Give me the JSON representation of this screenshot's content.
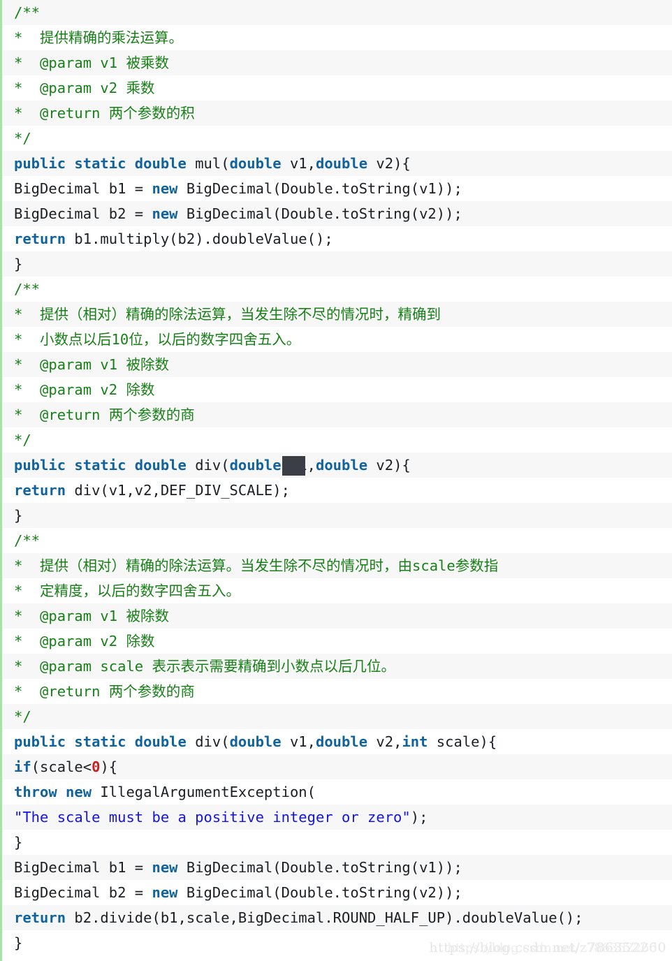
{
  "editor": {
    "language": "java",
    "colors": {
      "comment": "#178017",
      "keyword": "#10639c",
      "string": "#1414e0",
      "number": "#c92020",
      "plain": "#1b1f23",
      "row_odd_bg": "#f7f7f7",
      "row_even_bg": "#ffffff",
      "left_stripe": "#a6e3a6",
      "caret_block": "#3b3f45"
    },
    "caret": {
      "line_index": 18,
      "label": "text-cursor-block"
    },
    "lines": [
      {
        "i": 0,
        "text": "/**",
        "kind": "comment"
      },
      {
        "i": 1,
        "text": "* 提供精确的乘法运算。",
        "kind": "comment"
      },
      {
        "i": 2,
        "text": "* @param v1 被乘数",
        "kind": "comment"
      },
      {
        "i": 3,
        "text": "* @param v2 乘数",
        "kind": "comment"
      },
      {
        "i": 4,
        "text": "* @return 两个参数的积",
        "kind": "comment"
      },
      {
        "i": 5,
        "text": "*/",
        "kind": "comment"
      },
      {
        "i": 6,
        "text": "public static double mul(double v1,double v2){",
        "kind": "code"
      },
      {
        "i": 7,
        "text": "BigDecimal b1 = new BigDecimal(Double.toString(v1));",
        "kind": "code"
      },
      {
        "i": 8,
        "text": "BigDecimal b2 = new BigDecimal(Double.toString(v2));",
        "kind": "code"
      },
      {
        "i": 9,
        "text": "return b1.multiply(b2).doubleValue();",
        "kind": "code"
      },
      {
        "i": 10,
        "text": "}",
        "kind": "code"
      },
      {
        "i": 11,
        "text": "/**",
        "kind": "comment"
      },
      {
        "i": 12,
        "text": "* 提供（相对）精确的除法运算，当发生除不尽的情况时，精确到",
        "kind": "comment"
      },
      {
        "i": 13,
        "text": "* 小数点以后10位，以后的数字四舍五入。",
        "kind": "comment"
      },
      {
        "i": 14,
        "text": "* @param v1 被除数",
        "kind": "comment"
      },
      {
        "i": 15,
        "text": "* @param v2 除数",
        "kind": "comment"
      },
      {
        "i": 16,
        "text": "* @return 两个参数的商",
        "kind": "comment"
      },
      {
        "i": 17,
        "text": "*/",
        "kind": "comment"
      },
      {
        "i": 18,
        "text": "public static double div(double v1,double v2){",
        "kind": "code"
      },
      {
        "i": 19,
        "text": "return div(v1,v2,DEF_DIV_SCALE);",
        "kind": "code"
      },
      {
        "i": 20,
        "text": "}",
        "kind": "code"
      },
      {
        "i": 21,
        "text": "/**",
        "kind": "comment"
      },
      {
        "i": 22,
        "text": "* 提供（相对）精确的除法运算。当发生除不尽的情况时，由scale参数指",
        "kind": "comment"
      },
      {
        "i": 23,
        "text": "* 定精度，以后的数字四舍五入。",
        "kind": "comment"
      },
      {
        "i": 24,
        "text": "* @param v1 被除数",
        "kind": "comment"
      },
      {
        "i": 25,
        "text": "* @param v2 除数",
        "kind": "comment"
      },
      {
        "i": 26,
        "text": "* @param scale 表示表示需要精确到小数点以后几位。",
        "kind": "comment"
      },
      {
        "i": 27,
        "text": "* @return 两个参数的商",
        "kind": "comment"
      },
      {
        "i": 28,
        "text": "*/",
        "kind": "comment"
      },
      {
        "i": 29,
        "text": "public static double div(double v1,double v2,int scale){",
        "kind": "code"
      },
      {
        "i": 30,
        "text": "if(scale<0){",
        "kind": "code"
      },
      {
        "i": 31,
        "text": "throw new IllegalArgumentException(",
        "kind": "code"
      },
      {
        "i": 32,
        "text": "\"The scale must be a positive integer or zero\");",
        "kind": "code"
      },
      {
        "i": 33,
        "text": "}",
        "kind": "code"
      },
      {
        "i": 34,
        "text": "BigDecimal b1 = new BigDecimal(Double.toString(v1));",
        "kind": "code"
      },
      {
        "i": 35,
        "text": "BigDecimal b2 = new BigDecimal(Double.toString(v2));",
        "kind": "code"
      },
      {
        "i": 36,
        "text": "return b2.divide(b1,scale,BigDecimal.ROUND_HALF_UP).doubleValue();",
        "kind": "code"
      },
      {
        "i": 37,
        "text": "}",
        "kind": "code"
      }
    ],
    "tokens": [
      {
        "i": 0,
        "parts": [
          {
            "t": "/**",
            "c": "comment"
          }
        ]
      },
      {
        "i": 1,
        "parts": [
          {
            "t": "*  提供精确的乘法运算。",
            "c": "comment"
          }
        ]
      },
      {
        "i": 2,
        "parts": [
          {
            "t": "*  @param v1 被乘数",
            "c": "comment"
          }
        ]
      },
      {
        "i": 3,
        "parts": [
          {
            "t": "*  @param v2 乘数",
            "c": "comment"
          }
        ]
      },
      {
        "i": 4,
        "parts": [
          {
            "t": "*  @return 两个参数的积",
            "c": "comment"
          }
        ]
      },
      {
        "i": 5,
        "parts": [
          {
            "t": "*/",
            "c": "comment"
          }
        ]
      },
      {
        "i": 6,
        "parts": [
          {
            "t": "public static double ",
            "c": "kw"
          },
          {
            "t": "mul(",
            "c": "plain"
          },
          {
            "t": "double",
            "c": "kw"
          },
          {
            "t": " v1,",
            "c": "plain"
          },
          {
            "t": "double",
            "c": "kw"
          },
          {
            "t": " v2){",
            "c": "plain"
          }
        ]
      },
      {
        "i": 7,
        "parts": [
          {
            "t": "BigDecimal b1 = ",
            "c": "plain"
          },
          {
            "t": "new",
            "c": "kw"
          },
          {
            "t": " BigDecimal(Double.toString(v1));",
            "c": "plain"
          }
        ]
      },
      {
        "i": 8,
        "parts": [
          {
            "t": "BigDecimal b2 = ",
            "c": "plain"
          },
          {
            "t": "new",
            "c": "kw"
          },
          {
            "t": " BigDecimal(Double.toString(v2));",
            "c": "plain"
          }
        ]
      },
      {
        "i": 9,
        "parts": [
          {
            "t": "return",
            "c": "kw"
          },
          {
            "t": " b1.multiply(b2).doubleValue();",
            "c": "plain"
          }
        ]
      },
      {
        "i": 10,
        "parts": [
          {
            "t": "}",
            "c": "plain"
          }
        ]
      },
      {
        "i": 11,
        "parts": [
          {
            "t": "/**",
            "c": "comment"
          }
        ]
      },
      {
        "i": 12,
        "parts": [
          {
            "t": "*  提供（相对）精确的除法运算，当发生除不尽的情况时，精确到",
            "c": "comment"
          }
        ]
      },
      {
        "i": 13,
        "parts": [
          {
            "t": "*  小数点以后10位，以后的数字四舍五入。",
            "c": "comment"
          }
        ]
      },
      {
        "i": 14,
        "parts": [
          {
            "t": "*  @param v1 被除数",
            "c": "comment"
          }
        ]
      },
      {
        "i": 15,
        "parts": [
          {
            "t": "*  @param v2 除数",
            "c": "comment"
          }
        ]
      },
      {
        "i": 16,
        "parts": [
          {
            "t": "*  @return 两个参数的商",
            "c": "comment"
          }
        ]
      },
      {
        "i": 17,
        "parts": [
          {
            "t": "*/",
            "c": "comment"
          }
        ]
      },
      {
        "i": 18,
        "parts": [
          {
            "t": "public static double ",
            "c": "kw"
          },
          {
            "t": "div(",
            "c": "plain"
          },
          {
            "t": "double",
            "c": "kw"
          },
          {
            "t": " v1,",
            "c": "plain"
          },
          {
            "t": "double",
            "c": "kw"
          },
          {
            "t": " v2){",
            "c": "plain"
          }
        ]
      },
      {
        "i": 19,
        "parts": [
          {
            "t": "return",
            "c": "kw"
          },
          {
            "t": " div(v1,v2,DEF_DIV_SCALE);",
            "c": "plain"
          }
        ]
      },
      {
        "i": 20,
        "parts": [
          {
            "t": "}",
            "c": "plain"
          }
        ]
      },
      {
        "i": 21,
        "parts": [
          {
            "t": "/**",
            "c": "comment"
          }
        ]
      },
      {
        "i": 22,
        "parts": [
          {
            "t": "*  提供（相对）精确的除法运算。当发生除不尽的情况时，由scale参数指",
            "c": "comment"
          }
        ]
      },
      {
        "i": 23,
        "parts": [
          {
            "t": "*  定精度，以后的数字四舍五入。",
            "c": "comment"
          }
        ]
      },
      {
        "i": 24,
        "parts": [
          {
            "t": "*  @param v1 被除数",
            "c": "comment"
          }
        ]
      },
      {
        "i": 25,
        "parts": [
          {
            "t": "*  @param v2 除数",
            "c": "comment"
          }
        ]
      },
      {
        "i": 26,
        "parts": [
          {
            "t": "*  @param scale 表示表示需要精确到小数点以后几位。",
            "c": "comment"
          }
        ]
      },
      {
        "i": 27,
        "parts": [
          {
            "t": "*  @return 两个参数的商",
            "c": "comment"
          }
        ]
      },
      {
        "i": 28,
        "parts": [
          {
            "t": "*/",
            "c": "comment"
          }
        ]
      },
      {
        "i": 29,
        "parts": [
          {
            "t": "public static double ",
            "c": "kw"
          },
          {
            "t": "div(",
            "c": "plain"
          },
          {
            "t": "double",
            "c": "kw"
          },
          {
            "t": " v1,",
            "c": "plain"
          },
          {
            "t": "double",
            "c": "kw"
          },
          {
            "t": " v2,",
            "c": "plain"
          },
          {
            "t": "int",
            "c": "kw"
          },
          {
            "t": " scale){",
            "c": "plain"
          }
        ]
      },
      {
        "i": 30,
        "parts": [
          {
            "t": "if",
            "c": "kw"
          },
          {
            "t": "(scale<",
            "c": "plain"
          },
          {
            "t": "0",
            "c": "num"
          },
          {
            "t": "){",
            "c": "plain"
          }
        ]
      },
      {
        "i": 31,
        "parts": [
          {
            "t": "throw new",
            "c": "kw"
          },
          {
            "t": " IllegalArgumentException(",
            "c": "plain"
          }
        ]
      },
      {
        "i": 32,
        "parts": [
          {
            "t": "\"The scale must be a positive integer or zero\"",
            "c": "str"
          },
          {
            "t": ");",
            "c": "plain"
          }
        ]
      },
      {
        "i": 33,
        "parts": [
          {
            "t": "}",
            "c": "plain"
          }
        ]
      },
      {
        "i": 34,
        "parts": [
          {
            "t": "BigDecimal b1 = ",
            "c": "plain"
          },
          {
            "t": "new",
            "c": "kw"
          },
          {
            "t": " BigDecimal(Double.toString(v1));",
            "c": "plain"
          }
        ]
      },
      {
        "i": 35,
        "parts": [
          {
            "t": "BigDecimal b2 = ",
            "c": "plain"
          },
          {
            "t": "new",
            "c": "kw"
          },
          {
            "t": " BigDecimal(Double.toString(v2));",
            "c": "plain"
          }
        ]
      },
      {
        "i": 36,
        "parts": [
          {
            "t": "return",
            "c": "kw"
          },
          {
            "t": " b2.divide(b1,scale,BigDecimal.ROUND_HALF_UP).doubleValue();",
            "c": "plain"
          }
        ]
      },
      {
        "i": 37,
        "parts": [
          {
            "t": "}",
            "c": "plain"
          }
        ]
      }
    ]
  },
  "watermark": {
    "front": "https://blog.csdn.net/z786352260",
    "back": "https://blog.csdn.net/z786352260"
  }
}
